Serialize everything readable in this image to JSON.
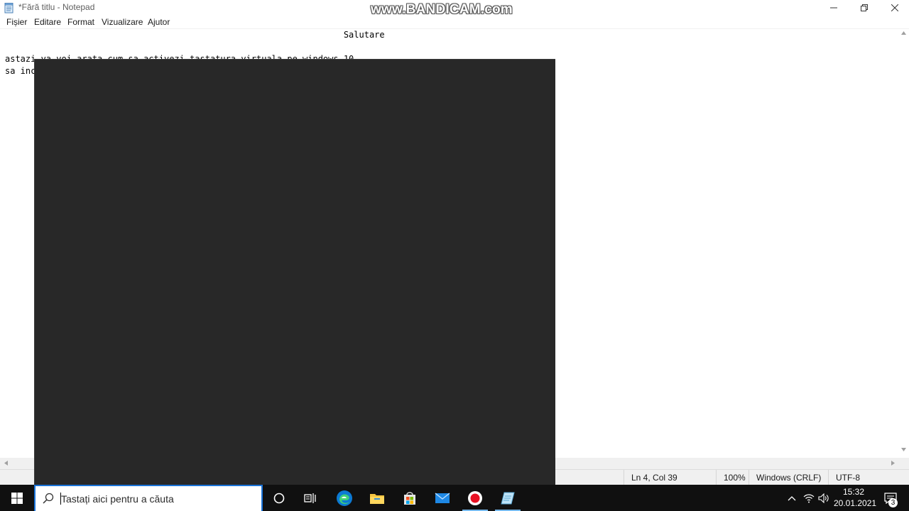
{
  "window": {
    "title": "*Fără titlu - Notepad",
    "watermark": "www.BANDICAM.com",
    "icon": "notepad-icon"
  },
  "menu": {
    "items": [
      "Fișier",
      "Editare",
      "Format",
      "Vizualizare",
      "Ajutor"
    ]
  },
  "editor": {
    "lines": [
      "                                                                  Salutare",
      "",
      "astazi va voi arata cum sa activezi tastatura virtuala pe windows 10",
      "sa inc"
    ]
  },
  "statusbar": {
    "position": "Ln 4, Col 39",
    "zoom": "100%",
    "line_ending": "Windows (CRLF)",
    "encoding": "UTF-8"
  },
  "taskbar": {
    "search_placeholder": "Tastați aici pentru a căuta",
    "pinned": [
      "cortana-icon",
      "task-view-icon",
      "edge-icon",
      "file-explorer-icon",
      "store-icon",
      "mail-icon",
      "bandicam-record-icon",
      "notepad-taskbar-icon"
    ],
    "tray": [
      "chevron-up-icon",
      "network-icon",
      "volume-icon"
    ],
    "time": "15:32",
    "date": "20.01.2021",
    "notifications": "3"
  },
  "colors": {
    "overlay": "#282828",
    "taskbar": "#101010",
    "search_border": "#1a73d9",
    "record_red": "#e81123"
  }
}
